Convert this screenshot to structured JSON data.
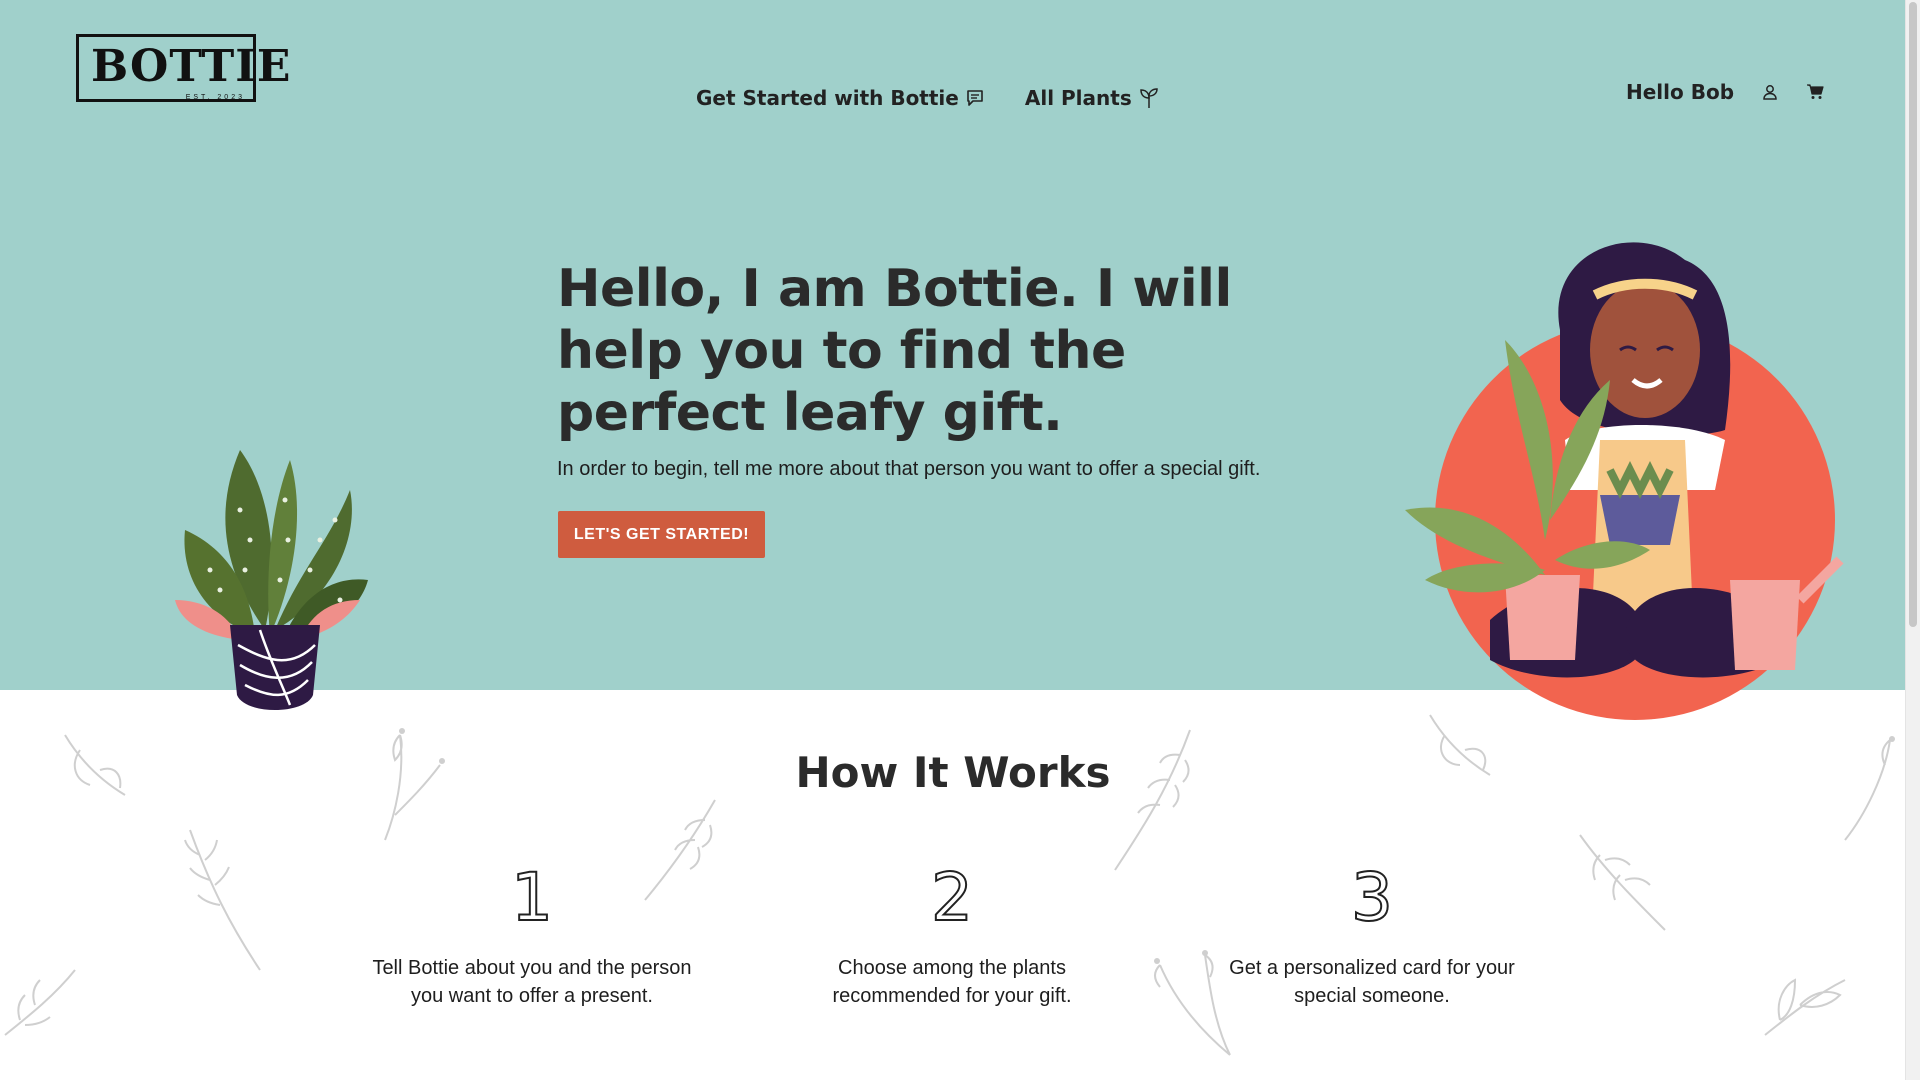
{
  "header": {
    "logo_text": "BOTTIE",
    "logo_est": "EST. 2023",
    "nav": [
      {
        "label": "Get Started with Bottie",
        "icon": "chat-icon"
      },
      {
        "label": "All Plants",
        "icon": "sprout-icon"
      }
    ],
    "greeting": "Hello Bob",
    "icons": [
      "user-icon",
      "cart-icon"
    ]
  },
  "hero": {
    "headline": "Hello, I am Bottie. I will help you to find the perfect leafy gift.",
    "subtext": "In order to begin, tell me more about that person you want to offer a special gift.",
    "cta_label": "LET'S GET STARTED!"
  },
  "how_it_works": {
    "title": "How It Works",
    "steps": [
      {
        "number": "1",
        "text": "Tell Bottie about you and the person you want to offer a present."
      },
      {
        "number": "2",
        "text": "Choose among the plants recommended for your gift."
      },
      {
        "number": "3",
        "text": "Get a personalized card for your special someone."
      }
    ]
  },
  "colors": {
    "hero_bg": "#a0d0cb",
    "cta_bg": "#cf5c3f",
    "accent_circle": "#f2644f"
  }
}
